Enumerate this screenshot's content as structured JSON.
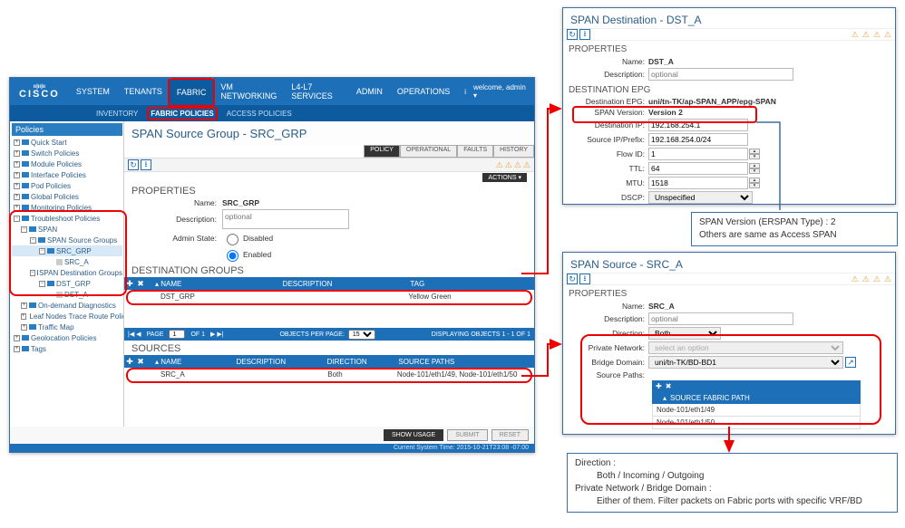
{
  "apic": {
    "logo_bars": "ıı|ıı|ıı",
    "logo_text": "CISCO",
    "top_tabs": [
      "SYSTEM",
      "TENANTS",
      "FABRIC",
      "VM NETWORKING",
      "L4-L7 SERVICES",
      "ADMIN",
      "OPERATIONS"
    ],
    "top_tabs_active": 2,
    "welcome": "welcome, admin ▾",
    "sub_tabs": [
      "INVENTORY",
      "FABRIC POLICIES",
      "ACCESS POLICIES"
    ],
    "sub_tabs_active": 1,
    "tree_header": "Policies",
    "tree": [
      {
        "lvl": 0,
        "exp": "+",
        "label": "Quick Start"
      },
      {
        "lvl": 0,
        "exp": "+",
        "label": "Switch Policies"
      },
      {
        "lvl": 0,
        "exp": "+",
        "label": "Module Policies"
      },
      {
        "lvl": 0,
        "exp": "+",
        "label": "Interface Policies"
      },
      {
        "lvl": 0,
        "exp": "+",
        "label": "Pod Policies"
      },
      {
        "lvl": 0,
        "exp": "+",
        "label": "Global Policies"
      },
      {
        "lvl": 0,
        "exp": "+",
        "label": "Monitoring Policies"
      },
      {
        "lvl": 0,
        "exp": "−",
        "label": "Troubleshoot Policies"
      },
      {
        "lvl": 1,
        "exp": "−",
        "label": "SPAN"
      },
      {
        "lvl": 2,
        "exp": "−",
        "label": "SPAN Source Groups"
      },
      {
        "lvl": 3,
        "exp": "−",
        "label": "SRC_GRP",
        "sel": true
      },
      {
        "lvl": 4,
        "exp": "",
        "label": "SRC_A",
        "leaf": true
      },
      {
        "lvl": 2,
        "exp": "−",
        "label": "SPAN Destination Groups"
      },
      {
        "lvl": 3,
        "exp": "−",
        "label": "DST_GRP"
      },
      {
        "lvl": 4,
        "exp": "",
        "label": "DST_A",
        "leaf": true
      },
      {
        "lvl": 1,
        "exp": "+",
        "label": "On-demand Diagnostics"
      },
      {
        "lvl": 1,
        "exp": "+",
        "label": "Leaf Nodes Trace Route Policy"
      },
      {
        "lvl": 1,
        "exp": "+",
        "label": "Traffic Map"
      },
      {
        "lvl": 0,
        "exp": "+",
        "label": "Geolocation Policies"
      },
      {
        "lvl": 0,
        "exp": "+",
        "label": "Tags"
      }
    ],
    "main_title": "SPAN Source Group - SRC_GRP",
    "tabs2": [
      "POLICY",
      "OPERATIONAL",
      "FAULTS",
      "HISTORY"
    ],
    "tabs2_active": 0,
    "actions_label": "ACTIONS ▾",
    "props_head": "PROPERTIES",
    "props": {
      "name_label": "Name:",
      "name_value": "SRC_GRP",
      "desc_label": "Description:",
      "desc_placeholder": "optional",
      "admin_label": "Admin State:",
      "disabled_label": "Disabled",
      "enabled_label": "Enabled"
    },
    "dest_head": "DESTINATION GROUPS",
    "dest_cols": [
      "NAME",
      "DESCRIPTION",
      "TAG"
    ],
    "dest_row": {
      "name": "DST_GRP",
      "desc": "",
      "tag": "Yellow Green"
    },
    "pager": {
      "page_label": "PAGE",
      "page_num": "1",
      "of_label": "OF 1",
      "opp_label": "OBJECTS PER PAGE:",
      "opp_value": "15",
      "display": "DISPLAYING OBJECTS 1 - 1 OF 1"
    },
    "src_head": "SOURCES",
    "src_cols": [
      "NAME",
      "DESCRIPTION",
      "DIRECTION",
      "SOURCE PATHS"
    ],
    "src_row": {
      "name": "SRC_A",
      "desc": "",
      "direction": "Both",
      "paths": "Node-101/eth1/49, Node-101/eth1/50"
    },
    "btn_show_usage": "SHOW USAGE",
    "btn_submit": "SUBMIT",
    "btn_reset": "RESET",
    "status_time": "Current System Time: 2015-10-21T23:08 -07:00"
  },
  "pop1": {
    "title": "SPAN Destination - DST_A",
    "props_head": "PROPERTIES",
    "name_label": "Name:",
    "name_value": "DST_A",
    "desc_label": "Description:",
    "desc_placeholder": "optional",
    "epg_head": "DESTINATION EPG",
    "dest_epg_label": "Destination EPG:",
    "dest_epg_value": "uni/tn-TK/ap-SPAN_APP/epg-SPAN",
    "span_ver_label": "SPAN Version:",
    "span_ver_value": "Version 2",
    "dest_ip_label": "Destination IP:",
    "dest_ip_value": "192.168.254.1",
    "src_ip_label": "Source IP/Prefix:",
    "src_ip_value": "192.168.254.0/24",
    "flow_label": "Flow ID:",
    "flow_value": "1",
    "ttl_label": "TTL:",
    "ttl_value": "64",
    "mtu_label": "MTU:",
    "mtu_value": "1518",
    "dscp_label": "DSCP:",
    "dscp_value": "Unspecified"
  },
  "pop2": {
    "title": "SPAN Source - SRC_A",
    "props_head": "PROPERTIES",
    "name_label": "Name:",
    "name_value": "SRC_A",
    "desc_label": "Description:",
    "desc_placeholder": "optional",
    "dir_label": "Direction:",
    "dir_value": "Both",
    "pn_label": "Private Network:",
    "pn_placeholder": "select an option",
    "bd_label": "Bridge Domain:",
    "bd_value": "uni/tn-TK/BD-BD1",
    "sp_label": "Source Paths:",
    "sp_head": "SOURCE FABRIC PATH",
    "sp_rows": [
      "Node-101/eth1/49",
      "Node-101/eth1/50"
    ]
  },
  "call1_line1": "SPAN Version (ERSPAN Type) : 2",
  "call1_line2": "Others are same as Access SPAN",
  "call2_line1": "Direction :",
  "call2_line2": "Both / Incoming / Outgoing",
  "call2_line3": "Private Network / Bridge Domain :",
  "call2_line4": "Either of them. Filter packets on Fabric ports with specific VRF/BD",
  "icons": {
    "refresh": "↻",
    "download": "⭳",
    "plus": "✚",
    "minus": "✖",
    "info": "i",
    "warn": "⚠",
    "up": "▲",
    "down": "▼",
    "tri_up": "▴",
    "tri_dn": "▾",
    "go": "↗"
  }
}
